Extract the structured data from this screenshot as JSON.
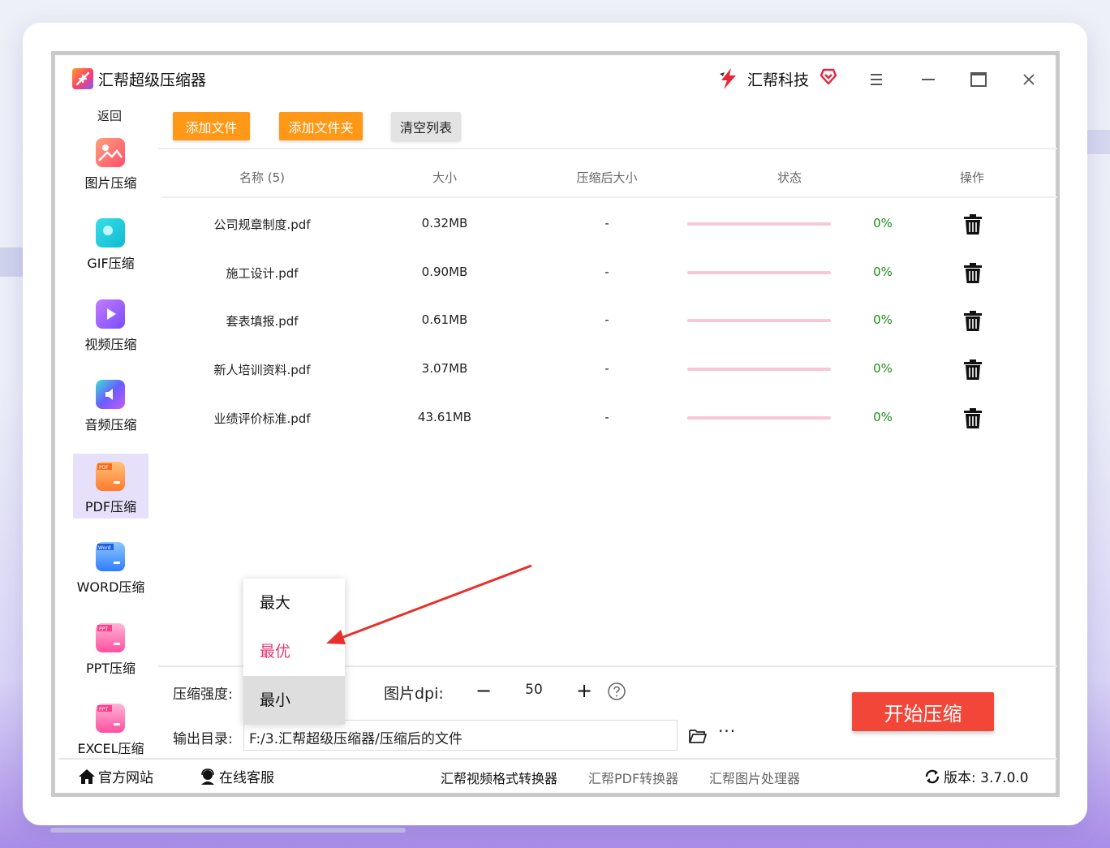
{
  "window": {
    "app_title": "汇帮超级压缩器",
    "brand_name": "汇帮科技"
  },
  "sidebar": {
    "back_label": "返回",
    "items": [
      {
        "label": "图片压缩",
        "icon": "image-compress-icon",
        "color": "#ff5f6d"
      },
      {
        "label": "GIF压缩",
        "icon": "gif-compress-icon",
        "color": "#19c7d6"
      },
      {
        "label": "视频压缩",
        "icon": "video-compress-icon",
        "color": "#9a5cff"
      },
      {
        "label": "音频压缩",
        "icon": "audio-compress-icon",
        "color": "#5f6bff"
      },
      {
        "label": "PDF压缩",
        "icon": "pdf-compress-icon",
        "color": "#ff8a34",
        "active": true
      },
      {
        "label": "WORD压缩",
        "icon": "word-compress-icon",
        "color": "#2f8cff"
      },
      {
        "label": "PPT压缩",
        "icon": "ppt-compress-icon",
        "color": "#ff5aa8"
      },
      {
        "label": "EXCEL压缩",
        "icon": "excel-compress-icon",
        "color": "#ff5aa8"
      }
    ]
  },
  "toolbar": {
    "add_file": "添加文件",
    "add_folder": "添加文件夹",
    "clear_list": "清空列表"
  },
  "table": {
    "headers": {
      "name": "名称 (5)",
      "size": "大小",
      "compressed_size": "压缩后大小",
      "status": "状态",
      "action": "操作"
    },
    "rows": [
      {
        "name": "公司规章制度.pdf",
        "size": "0.32MB",
        "compressed": "-",
        "progress": 0,
        "percent": "0%"
      },
      {
        "name": "施工设计.pdf",
        "size": "0.90MB",
        "compressed": "-",
        "progress": 0,
        "percent": "0%"
      },
      {
        "name": "套表填报.pdf",
        "size": "0.61MB",
        "compressed": "-",
        "progress": 0,
        "percent": "0%"
      },
      {
        "name": "新人培训资料.pdf",
        "size": "3.07MB",
        "compressed": "-",
        "progress": 0,
        "percent": "0%"
      },
      {
        "name": "业绩评价标准.pdf",
        "size": "43.61MB",
        "compressed": "-",
        "progress": 0,
        "percent": "0%"
      }
    ]
  },
  "settings": {
    "strength_label": "压缩强度:",
    "strength_options": [
      "最大",
      "最优",
      "最小"
    ],
    "strength_selected": "最优",
    "strength_hovered": "最小",
    "dpi_label": "图片dpi:",
    "dpi_minus": "−",
    "dpi_value": "50",
    "dpi_plus": "+",
    "output_label": "输出目录:",
    "output_path": "F:/3.汇帮超级压缩器/压缩后的文件",
    "more_label": "···",
    "start_button": "开始压缩"
  },
  "footer": {
    "official_site": "官方网站",
    "online_service": "在线客服",
    "video_converter": "汇帮视频格式转换器",
    "pdf_converter": "汇帮PDF转换器",
    "image_processor": "汇帮图片处理器",
    "version": "版本: 3.7.0.0"
  },
  "colors": {
    "accent_orange": "#fe9816",
    "start_red": "#f24638",
    "selected_pink": "#e03a72",
    "status_green": "#1a8c1a",
    "progress_track": "#f7c8d4",
    "annotation_arrow": "#e8302b"
  }
}
